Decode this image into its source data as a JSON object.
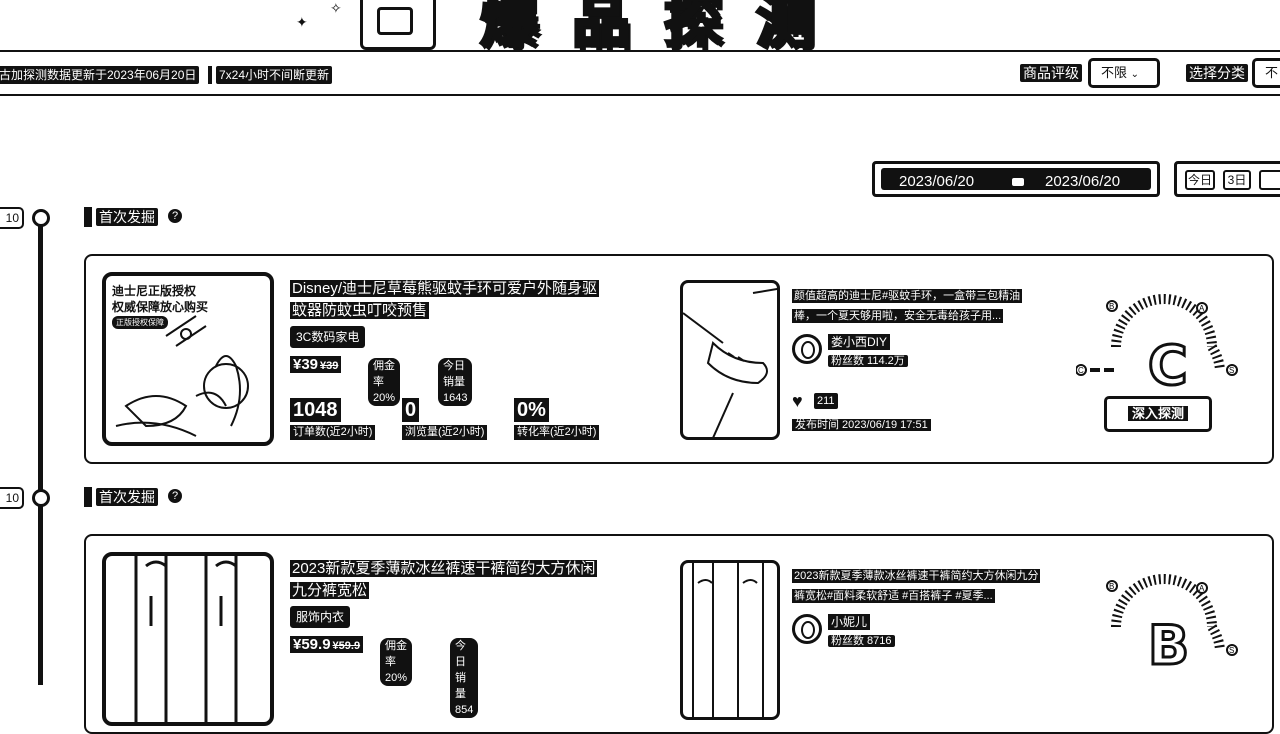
{
  "hero": {
    "title": "爆品探测"
  },
  "filterbar": {
    "update_text": "古加探测数据更新于2023年06月20日",
    "always_text": "7x24小时不间断更新",
    "rating_label": "商品评级",
    "rating_value": "不限",
    "category_label": "选择分类",
    "category_value": "不"
  },
  "daterange": {
    "start": "2023/06/20",
    "end": "2023/06/20",
    "quick": [
      "今日",
      "3日"
    ]
  },
  "timeline": {
    "time_labels": [
      "10",
      "10"
    ]
  },
  "sections": [
    {
      "header": "首次发掘",
      "thumb_lines": [
        "迪士尼正版授权",
        "权威保障放心购买"
      ],
      "thumb_badge": "正版授权保障",
      "title": "Disney/迪士尼草莓熊驱蚊手环可爱户外随身驱蚊器防蚊虫叮咬预售",
      "category": "3C数码家电",
      "price": "¥39",
      "old_price": "¥39",
      "commission": "佣金率20%",
      "today_sales": "今日销量 1643",
      "stats": [
        {
          "value": "1048",
          "label": "订单数(近2小时)"
        },
        {
          "value": "0",
          "label": "浏览量(近2小时)"
        },
        {
          "value": "0%",
          "label": "转化率(近2小时)"
        }
      ],
      "video_desc": "颜值超高的迪士尼#驱蚊手环，一盒带三包精油棒，一个夏天够用啦，安全无毒给孩子用...",
      "author": "娄小西DIY",
      "fans": "粉丝数 114.2万",
      "likes": "211",
      "publish": "发布时间 2023/06/19 17:51",
      "grade": "C",
      "explore_label": "深入探测"
    },
    {
      "header": "首次发掘",
      "title": "2023新款夏季薄款冰丝裤速干裤简约大方休闲九分裤宽松",
      "category": "服饰内衣",
      "price": "¥59.9",
      "old_price": "¥59.9",
      "commission": "佣金率20%",
      "today_sales": "今日销量 854",
      "video_desc": "2023新款夏季薄款冰丝裤速干裤简约大方休闲九分裤宽松#面料柔软舒适 #百搭裤子 #夏季...",
      "author": "小妮儿",
      "fans": "粉丝数 8716",
      "grade": "B"
    }
  ],
  "gauge_labels": {
    "left": "B",
    "top": "A",
    "right": "S",
    "low": "C"
  }
}
